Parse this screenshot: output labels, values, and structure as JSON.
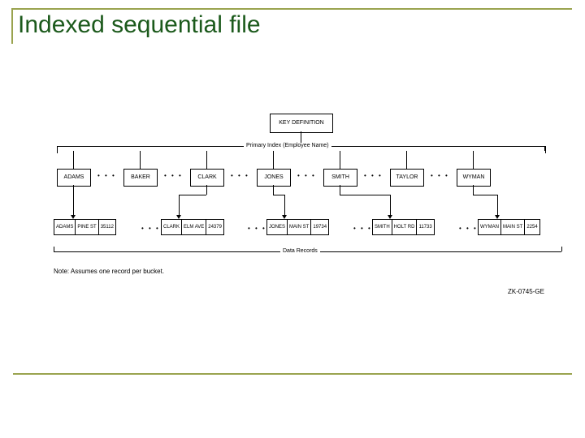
{
  "title": "Indexed sequential file",
  "keydef": "KEY DEFINITION",
  "primary_index_label": "Primary Index (Employee Name)",
  "data_records_label": "Data Records",
  "note": "Note: Assumes one record per bucket.",
  "figure_id": "ZK-0745-GE",
  "index_entries": [
    "ADAMS",
    "BAKER",
    "CLARK",
    "JONES",
    "SMITH",
    "TAYLOR",
    "WYMAN"
  ],
  "ellipsis": "• • •",
  "data_records": [
    {
      "name": "ADAMS",
      "street": "PINE ST",
      "code": "35112"
    },
    {
      "name": "CLARK",
      "street": "ELM AVE",
      "code": "24379"
    },
    {
      "name": "JONES",
      "street": "MAIN ST",
      "code": "19734"
    },
    {
      "name": "SMITH",
      "street": "HOLT RD",
      "code": "11733"
    },
    {
      "name": "WYMAN",
      "street": "MAIN ST",
      "code": "2254"
    }
  ]
}
